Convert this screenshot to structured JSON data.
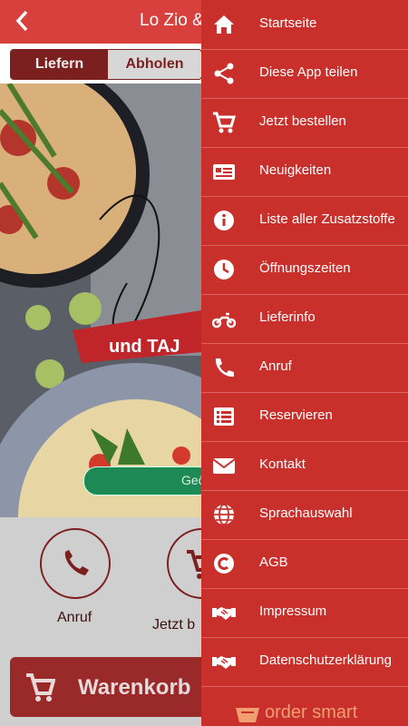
{
  "app": {
    "title": "Lo Zio &",
    "tabs": {
      "deliver": "Liefern",
      "pickup": "Abholen"
    },
    "banner": "und TAJ",
    "open_status": "Geö",
    "actions": [
      {
        "label": "Anruf",
        "icon": "phone-icon"
      },
      {
        "label": "Jetzt b",
        "icon": "cart-icon"
      }
    ],
    "cart": {
      "label": "Warenkorb"
    }
  },
  "menu": {
    "items": [
      {
        "label": "Startseite",
        "icon": "home-icon"
      },
      {
        "label": "Diese App teilen",
        "icon": "share-icon"
      },
      {
        "label": "Jetzt bestellen",
        "icon": "cart-icon"
      },
      {
        "label": "Neuigkeiten",
        "icon": "news-icon"
      },
      {
        "label": "Liste aller Zusatzstoffe",
        "icon": "info-icon"
      },
      {
        "label": "Öffnungszeiten",
        "icon": "clock-icon"
      },
      {
        "label": "Lieferinfo",
        "icon": "motorbike-icon"
      },
      {
        "label": "Anruf",
        "icon": "phone-icon"
      },
      {
        "label": "Reservieren",
        "icon": "list-icon"
      },
      {
        "label": "Kontakt",
        "icon": "mail-icon"
      },
      {
        "label": "Sprachauswahl",
        "icon": "globe-icon"
      },
      {
        "label": "AGB",
        "icon": "copyright-icon"
      },
      {
        "label": "Impressum",
        "icon": "handshake-icon"
      },
      {
        "label": "Datenschutzerklärung",
        "icon": "handshake-icon"
      }
    ],
    "brand": "order smart"
  },
  "colors": {
    "primary": "#c9302c",
    "topbar": "#d8403e",
    "dark_red": "#7b1f1f"
  }
}
